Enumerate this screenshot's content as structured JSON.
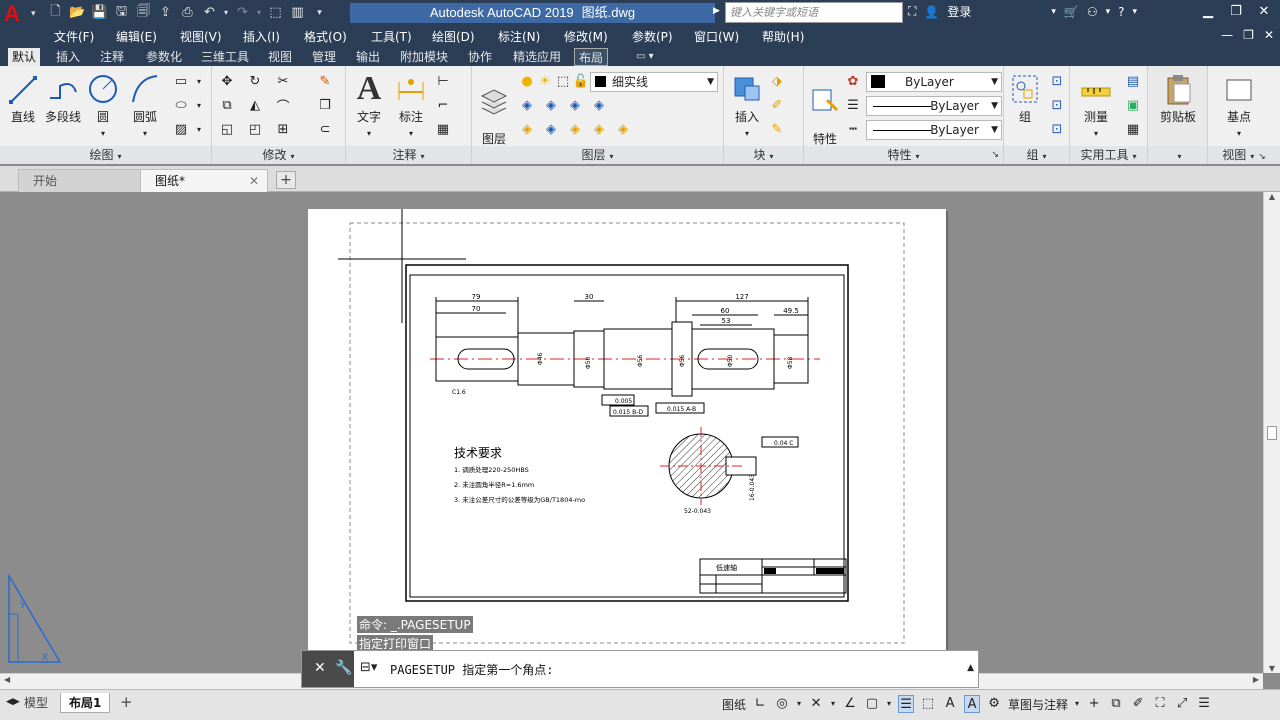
{
  "title": {
    "app_name": "Autodesk AutoCAD 2019",
    "doc_name": "图纸.dwg",
    "search_placeholder": "键入关键字或短语",
    "login": "登录"
  },
  "menu": [
    "文件(F)",
    "编辑(E)",
    "视图(V)",
    "插入(I)",
    "格式(O)",
    "工具(T)",
    "绘图(D)",
    "标注(N)",
    "修改(M)",
    "参数(P)",
    "窗口(W)",
    "帮助(H)"
  ],
  "ribbon_tabs": [
    "默认",
    "插入",
    "注释",
    "参数化",
    "三维工具",
    "视图",
    "管理",
    "输出",
    "附加模块",
    "协作",
    "精选应用",
    "布局"
  ],
  "ribbon": {
    "draw": {
      "title": "绘图",
      "line": "直线",
      "polyline": "多段线",
      "circle": "圆",
      "arc": "圆弧"
    },
    "modify": {
      "title": "修改"
    },
    "annotation": {
      "title": "注释",
      "text": "文字",
      "dimension": "标注"
    },
    "layers": {
      "title": "图层",
      "layer_props": "图层\n特性",
      "layer_name": "细实线"
    },
    "block": {
      "title": "块",
      "insert": "插入"
    },
    "properties": {
      "title": "特性",
      "match": "特性\n匹配",
      "color": "ByLayer",
      "linetype": "ByLayer",
      "lineweight": "ByLayer"
    },
    "groups": {
      "title": "组",
      "group": "组"
    },
    "utilities": {
      "title": "实用工具",
      "measure": "测量"
    },
    "clipboard": {
      "title": "剪贴板"
    },
    "view": {
      "title": "视图",
      "base": "基点"
    }
  },
  "file_tabs": [
    "开始",
    "图纸*"
  ],
  "drawing": {
    "tech_title": "技术要求",
    "req1": "1. 调质处理220-250HBS",
    "req2": "2. 未注圆角半径R=1.6mm",
    "req3": "3. 未注公差尺寸的公差等级为GB/T1804-mo",
    "part_name": "低速轴",
    "dims_top": [
      "79",
      "70",
      "30",
      "127",
      "60",
      "49.5",
      "53"
    ],
    "dims_vert": [
      "Φ46",
      "Φ50",
      "Φ56",
      "Φ56",
      "Φ50",
      "Φ58"
    ],
    "tol1": "0.005",
    "tol2": "0.015 B-D",
    "tol3": "0.015 A-B",
    "chamfer": "C1.6",
    "tol_sec": "0.04 C",
    "sec_dim": "52-0.043",
    "sec_dim2": "16-0.043"
  },
  "command": {
    "history1": "命令: _.PAGESETUP",
    "history2": "指定打印窗口",
    "current": "PAGESETUP 指定第一个角点:"
  },
  "layout_tabs": [
    "模型",
    "布局1"
  ],
  "status": {
    "paper": "图纸",
    "workspace": "草图与注释"
  }
}
